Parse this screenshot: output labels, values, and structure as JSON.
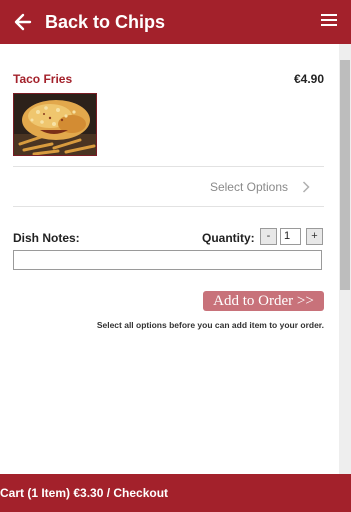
{
  "header": {
    "back_label": "Back to Chips",
    "back_icon": "arrow-left-icon",
    "menu_icon": "hamburger-menu-icon",
    "bar_color": "#a3212b"
  },
  "item": {
    "name": "Taco Fries",
    "price": "€4.90",
    "name_color": "#a3212b"
  },
  "options": {
    "label": "Select Options",
    "icon": "chevron-right-icon"
  },
  "notes": {
    "label": "Dish Notes:",
    "value": ""
  },
  "quantity": {
    "label": "Quantity:",
    "decrement": "-",
    "value": "1",
    "increment": "+"
  },
  "actions": {
    "add_to_order": "Add to Order >>",
    "hint": "Select all options before you can add item to your order.",
    "button_color": "#c8727a"
  },
  "cart": {
    "summary": "Cart (1 Item) €3.30 / Checkout"
  }
}
